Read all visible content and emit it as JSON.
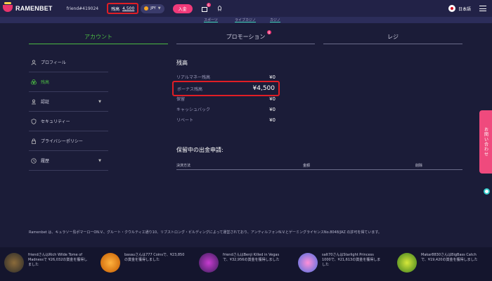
{
  "header": {
    "brand": "RAMENBET",
    "username": "friend#419024",
    "balance_label": "残高",
    "balance_value": "4,500",
    "currency": "JPY",
    "deposit_label": "入金",
    "gift_badge": "6",
    "language": "日本語"
  },
  "subnav": [
    "スポーツ",
    "ライブカジノ",
    "カジノ"
  ],
  "tabs": [
    {
      "label": "アカウント",
      "active": true
    },
    {
      "label": "プロモーション",
      "badge": "6"
    },
    {
      "label": "レジ"
    }
  ],
  "sidebar": {
    "items": [
      {
        "label": "プロフィール",
        "icon": "user-icon"
      },
      {
        "label": "残高",
        "icon": "coins-icon",
        "active": true
      },
      {
        "label": "認証",
        "icon": "id-icon",
        "has_chevron": true
      },
      {
        "label": "セキュリティー",
        "icon": "shield-icon"
      },
      {
        "label": "プライバシーポリシー",
        "icon": "lock-icon"
      },
      {
        "label": "履歴",
        "icon": "clock-icon",
        "has_chevron": true
      }
    ]
  },
  "balance": {
    "title": "残高",
    "rows": [
      {
        "label": "リアルマネー残高",
        "value": "¥0"
      },
      {
        "label": "ボーナス残高",
        "value": "¥4,500"
      },
      {
        "label": "保留",
        "value": "¥0"
      },
      {
        "label": "キャッシュバック",
        "value": "¥0"
      },
      {
        "label": "リベート",
        "value": "¥0"
      }
    ]
  },
  "pending": {
    "title": "保留中の出金申請:",
    "columns": [
      "決済方法",
      "金額",
      "削除"
    ]
  },
  "contact_tab": "お問い合わせ",
  "footer": {
    "legal": "Ramenbet は、キュラソー島ポマーローON.V.、グルート・クウルティエ通り10、リブストロング・ビルディングによって運営されており、アンティルフォンN.V.とゲーミングライセンスNo.8048/JAZ の許可を得ています。"
  },
  "ticker": [
    {
      "text": "friendさんはRich Wilde Tome of Madnessで ¥26,032の賞金を獲得しました"
    },
    {
      "text": "basauさんは777 Coinsで、¥23,850の賞金を獲得しました"
    },
    {
      "text": "friendさんはBenji Killed in Vegasで、¥32,956の賞金を獲得しました"
    },
    {
      "text": "salt70さんはStarlight Princess 1000で、¥21,613の賞金を獲得しました"
    },
    {
      "text": "Makar8830さんはBigBass Catchで、¥19,420の賞金を獲得しました"
    }
  ],
  "colors": {
    "accent_green": "#4bb943",
    "accent_pink": "#f03a7a",
    "highlight_red": "#e01e25",
    "background": "#1b1c38"
  }
}
